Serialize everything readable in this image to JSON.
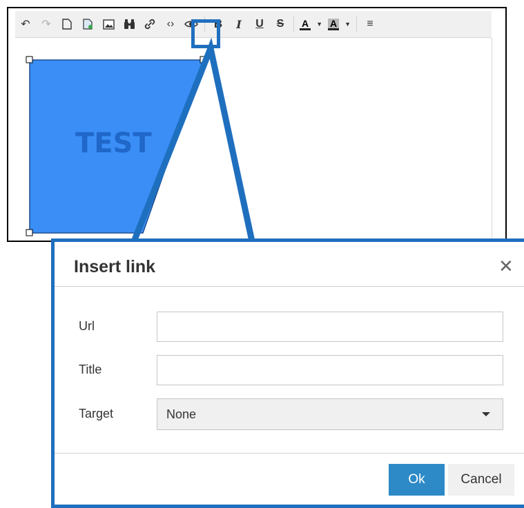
{
  "toolbar": {
    "items": [
      {
        "name": "undo-icon",
        "glyph": "↶",
        "disabled": false
      },
      {
        "name": "redo-icon",
        "glyph": "↷",
        "disabled": true
      },
      {
        "name": "new-document-icon",
        "glyph": "🗋",
        "disabled": false
      },
      {
        "name": "insert-image-file-icon",
        "glyph": "▣",
        "disabled": false
      },
      {
        "name": "image-icon",
        "glyph": "▨",
        "disabled": false
      },
      {
        "name": "find-icon",
        "glyph": "⚲",
        "disabled": false
      },
      {
        "name": "link-icon",
        "glyph": "🔗",
        "disabled": false
      },
      {
        "name": "code-icon",
        "glyph": "‹›",
        "disabled": false
      },
      {
        "name": "preview-eye-icon",
        "glyph": "◉",
        "disabled": false
      }
    ],
    "bold": "B",
    "italic": "I",
    "underline": "U",
    "strike": "S",
    "text_color": "A",
    "bg_color": "A",
    "align_glyph": "≡"
  },
  "shape": {
    "label": "TEST",
    "fill": "#3a8ef6",
    "text_color": "#1f67c8"
  },
  "dialog": {
    "title": "Insert link",
    "close_glyph": "✕",
    "fields": {
      "url_label": "Url",
      "url_value": "",
      "title_label": "Title",
      "title_value": "",
      "target_label": "Target",
      "target_value": "None"
    },
    "ok_label": "Ok",
    "cancel_label": "Cancel"
  },
  "colors": {
    "callout_blue": "#1f6fbf",
    "ok_blue": "#2d8ac7"
  }
}
